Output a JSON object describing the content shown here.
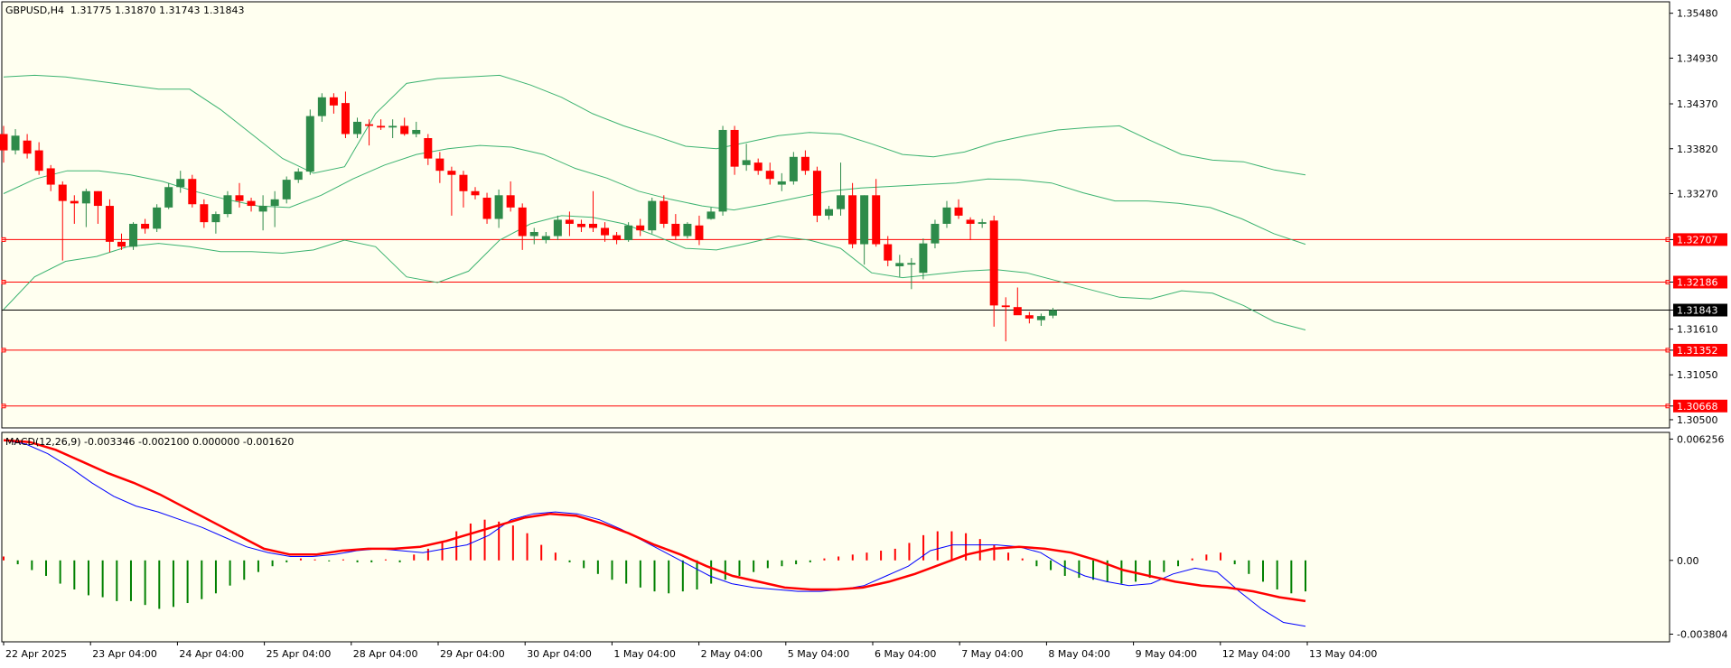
{
  "chart_data": [
    {
      "type": "candlestick",
      "symbol_label": "GBPUSD,H4",
      "ohlc_label": "1.31775 1.31870 1.31743 1.31843",
      "last_price": "1.31843",
      "y_ticks": [
        "1.35480",
        "1.34930",
        "1.34370",
        "1.33820",
        "1.33270",
        "1.32707",
        "1.32186",
        "1.31843",
        "1.31610",
        "1.31352",
        "1.31050",
        "1.30668",
        "1.30500"
      ],
      "y_tick_values": [
        1.3548,
        1.3493,
        1.3437,
        1.3382,
        1.3327,
        1.32707,
        1.32186,
        1.31843,
        1.3161,
        1.31352,
        1.3105,
        1.30668,
        1.305
      ],
      "horizontal_lines": [
        {
          "value": 1.32707,
          "label": "1.32707",
          "color": "#ff0000"
        },
        {
          "value": 1.32186,
          "label": "1.32186",
          "color": "#ff0000"
        },
        {
          "value": 1.31352,
          "label": "1.31352",
          "color": "#ff0000"
        },
        {
          "value": 1.30668,
          "label": "1.30668",
          "color": "#ff0000"
        }
      ],
      "x_labels": [
        "22 Apr 2025",
        "23 Apr 04:00",
        "24 Apr 04:00",
        "25 Apr 04:00",
        "28 Apr 04:00",
        "29 Apr 04:00",
        "30 Apr 04:00",
        "1 May 04:00",
        "2 May 04:00",
        "5 May 04:00",
        "6 May 04:00",
        "7 May 04:00",
        "8 May 04:00",
        "9 May 04:00",
        "12 May 04:00",
        "13 May 04:00"
      ],
      "candles": [
        [
          1.34,
          1.341,
          1.3365,
          1.338
        ],
        [
          1.338,
          1.3406,
          1.3375,
          1.3398
        ],
        [
          1.3392,
          1.34,
          1.337,
          1.3376
        ],
        [
          1.338,
          1.339,
          1.335,
          1.3355
        ],
        [
          1.3358,
          1.3362,
          1.333,
          1.3338
        ],
        [
          1.3338,
          1.3342,
          1.3245,
          1.3318
        ],
        [
          1.3318,
          1.3325,
          1.329,
          1.3315
        ],
        [
          1.3315,
          1.3333,
          1.3286,
          1.333
        ],
        [
          1.333,
          1.333,
          1.329,
          1.3312
        ],
        [
          1.3312,
          1.332,
          1.3255,
          1.3268
        ],
        [
          1.3268,
          1.3278,
          1.3258,
          1.3262
        ],
        [
          1.3262,
          1.3292,
          1.3258,
          1.329
        ],
        [
          1.329,
          1.3296,
          1.3278,
          1.3284
        ],
        [
          1.3284,
          1.3314,
          1.328,
          1.331
        ],
        [
          1.331,
          1.334,
          1.3308,
          1.3335
        ],
        [
          1.3335,
          1.3355,
          1.3328,
          1.3345
        ],
        [
          1.3345,
          1.335,
          1.331,
          1.3314
        ],
        [
          1.3314,
          1.332,
          1.3285,
          1.3292
        ],
        [
          1.3292,
          1.3305,
          1.3278,
          1.3302
        ],
        [
          1.3302,
          1.333,
          1.3298,
          1.3325
        ],
        [
          1.3325,
          1.334,
          1.331,
          1.3318
        ],
        [
          1.3318,
          1.3322,
          1.3305,
          1.3312
        ],
        [
          1.3305,
          1.3325,
          1.3282,
          1.3312
        ],
        [
          1.3312,
          1.333,
          1.3286,
          1.332
        ],
        [
          1.332,
          1.3348,
          1.3315,
          1.3344
        ],
        [
          1.3344,
          1.3358,
          1.334,
          1.3354
        ],
        [
          1.3354,
          1.343,
          1.335,
          1.3422
        ],
        [
          1.3422,
          1.345,
          1.3415,
          1.3445
        ],
        [
          1.3445,
          1.345,
          1.3425,
          1.3435
        ],
        [
          1.3438,
          1.3452,
          1.3395,
          1.34
        ],
        [
          1.34,
          1.342,
          1.3395,
          1.3415
        ],
        [
          1.3412,
          1.3418,
          1.3386,
          1.341
        ],
        [
          1.341,
          1.3418,
          1.3405,
          1.3408
        ],
        [
          1.3408,
          1.3418,
          1.3395,
          1.341
        ],
        [
          1.341,
          1.342,
          1.3398,
          1.34
        ],
        [
          1.34,
          1.3415,
          1.3396,
          1.3405
        ],
        [
          1.3395,
          1.34,
          1.3362,
          1.337
        ],
        [
          1.337,
          1.3378,
          1.334,
          1.3355
        ],
        [
          1.3355,
          1.336,
          1.33,
          1.335
        ],
        [
          1.335,
          1.3355,
          1.331,
          1.333
        ],
        [
          1.333,
          1.3335,
          1.332,
          1.3325
        ],
        [
          1.3322,
          1.3328,
          1.329,
          1.3296
        ],
        [
          1.3296,
          1.3332,
          1.3285,
          1.3325
        ],
        [
          1.3325,
          1.3342,
          1.3305,
          1.331
        ],
        [
          1.331,
          1.3315,
          1.3258,
          1.3275
        ],
        [
          1.3275,
          1.3285,
          1.3265,
          1.328
        ],
        [
          1.327,
          1.328,
          1.3266,
          1.3275
        ],
        [
          1.3275,
          1.33,
          1.327,
          1.3295
        ],
        [
          1.3295,
          1.3305,
          1.3275,
          1.329
        ],
        [
          1.329,
          1.3295,
          1.328,
          1.3286
        ],
        [
          1.329,
          1.333,
          1.328,
          1.3285
        ],
        [
          1.3285,
          1.3292,
          1.3268,
          1.3276
        ],
        [
          1.3276,
          1.328,
          1.3265,
          1.327
        ],
        [
          1.327,
          1.3292,
          1.3268,
          1.3288
        ],
        [
          1.3288,
          1.3296,
          1.3275,
          1.3282
        ],
        [
          1.3282,
          1.3322,
          1.3278,
          1.3318
        ],
        [
          1.3318,
          1.3325,
          1.3285,
          1.329
        ],
        [
          1.329,
          1.3302,
          1.327,
          1.3275
        ],
        [
          1.3275,
          1.3292,
          1.3272,
          1.329
        ],
        [
          1.3288,
          1.33,
          1.3264,
          1.327
        ],
        [
          1.3296,
          1.331,
          1.3295,
          1.3305
        ],
        [
          1.3305,
          1.341,
          1.33,
          1.3405
        ],
        [
          1.3405,
          1.341,
          1.335,
          1.336
        ],
        [
          1.3362,
          1.3388,
          1.3355,
          1.3368
        ],
        [
          1.3365,
          1.337,
          1.335,
          1.3355
        ],
        [
          1.3355,
          1.3365,
          1.3338,
          1.3345
        ],
        [
          1.3338,
          1.3352,
          1.333,
          1.3342
        ],
        [
          1.3342,
          1.3378,
          1.3338,
          1.3372
        ],
        [
          1.3372,
          1.338,
          1.335,
          1.3355
        ],
        [
          1.3355,
          1.336,
          1.3292,
          1.33
        ],
        [
          1.33,
          1.3312,
          1.3295,
          1.3308
        ],
        [
          1.3308,
          1.3365,
          1.33,
          1.3325
        ],
        [
          1.3325,
          1.334,
          1.326,
          1.3265
        ],
        [
          1.3265,
          1.3325,
          1.324,
          1.3325
        ],
        [
          1.3325,
          1.3345,
          1.3262,
          1.3265
        ],
        [
          1.3265,
          1.3275,
          1.3238,
          1.3245
        ],
        [
          1.3238,
          1.3252,
          1.3225,
          1.3242
        ],
        [
          1.324,
          1.3248,
          1.321,
          1.3242
        ],
        [
          1.323,
          1.3272,
          1.3222,
          1.3266
        ],
        [
          1.3266,
          1.3295,
          1.326,
          1.329
        ],
        [
          1.329,
          1.3318,
          1.3285,
          1.331
        ],
        [
          1.331,
          1.332,
          1.3296,
          1.33
        ],
        [
          1.3295,
          1.3298,
          1.327,
          1.329
        ],
        [
          1.329,
          1.3296,
          1.3285,
          1.3292
        ],
        [
          1.3294,
          1.33,
          1.3164,
          1.319
        ],
        [
          1.319,
          1.32,
          1.3146,
          1.3188
        ],
        [
          1.3188,
          1.3212,
          1.318,
          1.3178
        ],
        [
          1.3178,
          1.3182,
          1.3168,
          1.3174
        ],
        [
          1.3172,
          1.318,
          1.3165,
          1.3177
        ],
        [
          1.31775,
          1.3187,
          1.31743,
          1.31843
        ]
      ],
      "bollinger_bands": {
        "upper": [
          1.347,
          1.3472,
          1.347,
          1.3465,
          1.346,
          1.3455,
          1.3455,
          1.343,
          1.34,
          1.337,
          1.3352,
          1.336,
          1.3425,
          1.3462,
          1.3468,
          1.347,
          1.3472,
          1.346,
          1.3445,
          1.3425,
          1.341,
          1.3398,
          1.3385,
          1.3382,
          1.339,
          1.3398,
          1.3402,
          1.34,
          1.3388,
          1.3375,
          1.3372,
          1.3378,
          1.339,
          1.3398,
          1.3405,
          1.3408,
          1.341,
          1.3392,
          1.3375,
          1.3368,
          1.3366,
          1.3356,
          1.335
        ],
        "middle": [
          1.3327,
          1.3345,
          1.3355,
          1.3355,
          1.335,
          1.3342,
          1.333,
          1.332,
          1.3312,
          1.331,
          1.3325,
          1.3345,
          1.3362,
          1.3375,
          1.3382,
          1.3386,
          1.3384,
          1.3375,
          1.3358,
          1.3346,
          1.333,
          1.332,
          1.3312,
          1.3307,
          1.3314,
          1.3322,
          1.333,
          1.3334,
          1.3336,
          1.3338,
          1.334,
          1.3345,
          1.3344,
          1.334,
          1.3328,
          1.3318,
          1.3318,
          1.3315,
          1.331,
          1.3296,
          1.3278,
          1.3265
        ],
        "lower": [
          1.3185,
          1.3225,
          1.3244,
          1.325,
          1.3262,
          1.3266,
          1.3262,
          1.3256,
          1.3256,
          1.3254,
          1.3258,
          1.327,
          1.3262,
          1.3225,
          1.3218,
          1.3232,
          1.327,
          1.329,
          1.33,
          1.3298,
          1.329,
          1.3276,
          1.326,
          1.3258,
          1.3266,
          1.3275,
          1.327,
          1.326,
          1.323,
          1.3224,
          1.3228,
          1.3232,
          1.3234,
          1.323,
          1.322,
          1.321,
          1.32,
          1.3198,
          1.3208,
          1.3205,
          1.319,
          1.317,
          1.316
        ]
      }
    },
    {
      "type": "macd",
      "label": "MACD(12,26,9) -0.003346 -0.002100 0.000000 -0.001620",
      "y_ticks": [
        "0.006256",
        "0.00",
        "-0.003804"
      ],
      "y_tick_values": [
        0.006256,
        0.0,
        -0.003804
      ],
      "histogram": [
        0.0002,
        -0.0002,
        -0.0005,
        -0.0008,
        -0.0012,
        -0.0015,
        -0.0018,
        -0.0019,
        -0.0021,
        -0.0021,
        -0.0023,
        -0.0025,
        -0.0024,
        -0.0022,
        -0.002,
        -0.0017,
        -0.0013,
        -0.001,
        -0.0006,
        -0.0003,
        -0.0001,
        0.0001,
        5e-05,
        -5e-05,
        5e-05,
        -0.0001,
        -0.0001,
        5e-05,
        -0.0001,
        0.0003,
        0.0006,
        0.001,
        0.0015,
        0.0019,
        0.0021,
        0.002,
        0.0018,
        0.0014,
        0.0008,
        0.0004,
        -0.0001,
        -0.0004,
        -0.0007,
        -0.001,
        -0.0012,
        -0.0014,
        -0.0016,
        -0.0017,
        -0.0016,
        -0.0015,
        -0.0012,
        -0.001,
        -0.0008,
        -0.0006,
        -0.0004,
        -0.0003,
        -0.0002,
        -0.0001,
        0.0001,
        0.0002,
        0.0003,
        0.0004,
        0.0005,
        0.0006,
        0.0009,
        0.0013,
        0.0015,
        0.0015,
        0.0014,
        0.0011,
        0.0008,
        0.0004,
        0.0001,
        -0.0003,
        -0.0005,
        -0.0008,
        -0.0009,
        -0.001,
        -0.0011,
        -0.0012,
        -0.0011,
        -0.0009,
        -0.0006,
        -0.0003,
        0.0001,
        0.0003,
        0.0004,
        -0.0002,
        -0.0007,
        -0.0011,
        -0.0015,
        -0.0017,
        -0.0016
      ],
      "macd": [
        0.0062,
        0.006,
        0.0055,
        0.0048,
        0.004,
        0.0033,
        0.0028,
        0.0025,
        0.0021,
        0.0017,
        0.0012,
        0.0007,
        0.0004,
        0.0002,
        0.0002,
        0.0003,
        0.0005,
        0.0006,
        0.0005,
        0.0004,
        0.0006,
        0.0008,
        0.0013,
        0.0021,
        0.0024,
        0.0025,
        0.0024,
        0.0021,
        0.0016,
        0.001,
        0.0004,
        -0.0002,
        -0.0008,
        -0.0012,
        -0.0014,
        -0.0015,
        -0.0016,
        -0.0016,
        -0.0015,
        -0.0013,
        -0.0008,
        -0.0003,
        0.0005,
        0.0008,
        0.0008,
        0.0008,
        0.0007,
        0.0004,
        -0.0003,
        -0.0008,
        -0.0011,
        -0.0013,
        -0.0012,
        -0.0007,
        -0.0004,
        -0.0006,
        -0.0016,
        -0.0025,
        -0.0032,
        -0.0034
      ],
      "signal": [
        0.0062,
        0.0061,
        0.0057,
        0.0051,
        0.0045,
        0.004,
        0.0034,
        0.0027,
        0.002,
        0.0013,
        0.0006,
        0.0003,
        0.0003,
        0.0005,
        0.0006,
        0.0006,
        0.0007,
        0.001,
        0.0014,
        0.0018,
        0.0022,
        0.0024,
        0.0023,
        0.0019,
        0.0014,
        0.0008,
        0.0003,
        -0.0003,
        -0.0008,
        -0.0011,
        -0.0014,
        -0.0015,
        -0.0015,
        -0.0014,
        -0.0011,
        -0.0007,
        -0.0002,
        0.0003,
        0.0006,
        0.0007,
        0.0006,
        0.0004,
        0.0,
        -0.0005,
        -0.0008,
        -0.0011,
        -0.0013,
        -0.0014,
        -0.0016,
        -0.0019,
        -0.0021
      ]
    }
  ],
  "colors": {
    "background": "#fffff0",
    "bull": "#2e8b4a",
    "bear": "#ff0000",
    "band": "#3cb371",
    "grid_frame": "#000000",
    "hline": "#ff0000",
    "last_price_line": "#000000",
    "macd_line": "#0000ff",
    "signal_line": "#ff0000",
    "hist_pos": "#ff0000",
    "hist_neg": "#008000"
  }
}
